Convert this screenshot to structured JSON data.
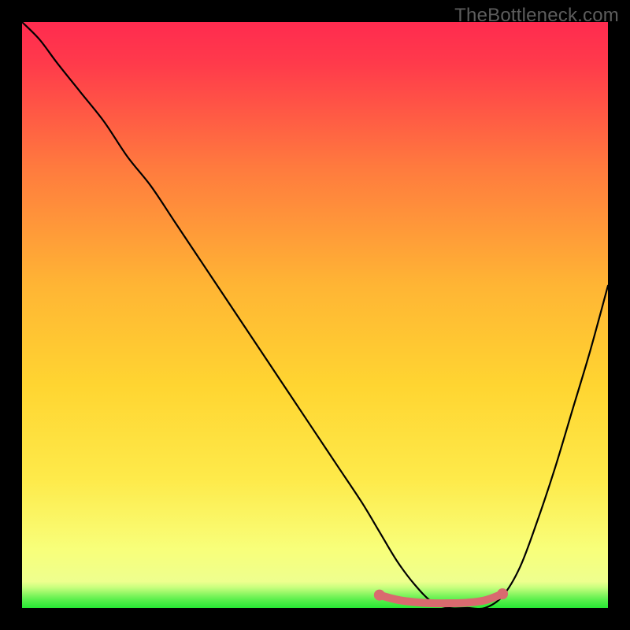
{
  "watermark": "TheBottleneck.com",
  "chart_data": {
    "type": "line",
    "title": "",
    "xlabel": "",
    "ylabel": "",
    "xlim": [
      0,
      100
    ],
    "ylim": [
      0,
      100
    ],
    "legend": false,
    "grid": false,
    "background_gradient": {
      "top_color": "#ff2b4f",
      "mid_color": "#ffd531",
      "low_color": "#f8ff7a",
      "bottom_strip_color": "#27e833"
    },
    "series": [
      {
        "name": "bottleneck-curve",
        "color": "#000000",
        "x": [
          0,
          3,
          6,
          10,
          14,
          18,
          22,
          26,
          30,
          34,
          38,
          42,
          46,
          50,
          54,
          58,
          61,
          64,
          67,
          70,
          73,
          76,
          79,
          82,
          85,
          88,
          91,
          94,
          97,
          100
        ],
        "y": [
          100,
          97,
          93,
          88,
          83,
          77,
          72,
          66,
          60,
          54,
          48,
          42,
          36,
          30,
          24,
          18,
          13,
          8,
          4,
          1,
          0,
          0,
          0,
          2,
          7,
          15,
          24,
          34,
          44,
          55
        ]
      }
    ],
    "highlight": {
      "name": "optimal-range",
      "color": "#d96a6f",
      "x": [
        61,
        64,
        67,
        70,
        73,
        76,
        79,
        82
      ],
      "y": [
        2.2,
        1.4,
        1.0,
        0.8,
        0.8,
        0.9,
        1.3,
        2.4
      ]
    }
  }
}
